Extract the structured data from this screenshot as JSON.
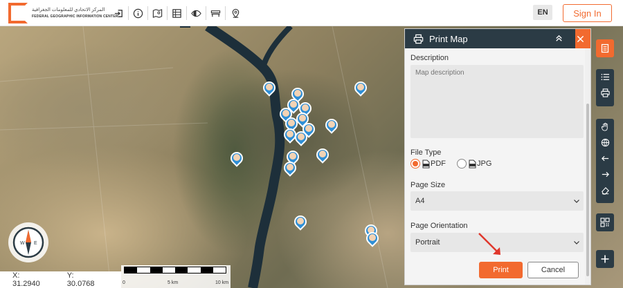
{
  "header": {
    "logo_ar": "المركز الاتحادي للمعلومات الجغرافية",
    "logo_en": "FEDERAL GEOGRAPHIC INFORMATION CENTER",
    "tools": [
      "login-icon",
      "info-icon",
      "map-icon",
      "table-icon",
      "eye-icon",
      "bench-icon",
      "location-icon"
    ],
    "lang": "EN",
    "signin": "Sign In"
  },
  "coords": {
    "x": "X: 31.2940",
    "y": "Y: 30.0768"
  },
  "scale": {
    "labels": [
      "0",
      "5 km",
      "10 km"
    ]
  },
  "panel": {
    "title": "Print Map",
    "description_label": "Description",
    "description_placeholder": "Map description",
    "file_type_label": "File Type",
    "file_types": [
      "PDF",
      "JPG"
    ],
    "selected_file_type": "PDF",
    "page_size_label": "Page Size",
    "page_size": "A4",
    "orientation_label": "Page Orientation",
    "orientation": "Portrait",
    "print_label": "Print",
    "cancel_label": "Cancel"
  },
  "compass": {
    "w": "W",
    "e": "E"
  },
  "colors": {
    "accent": "#f26a2f",
    "dark": "#2b3b45",
    "pin": "#2f8fd6"
  }
}
